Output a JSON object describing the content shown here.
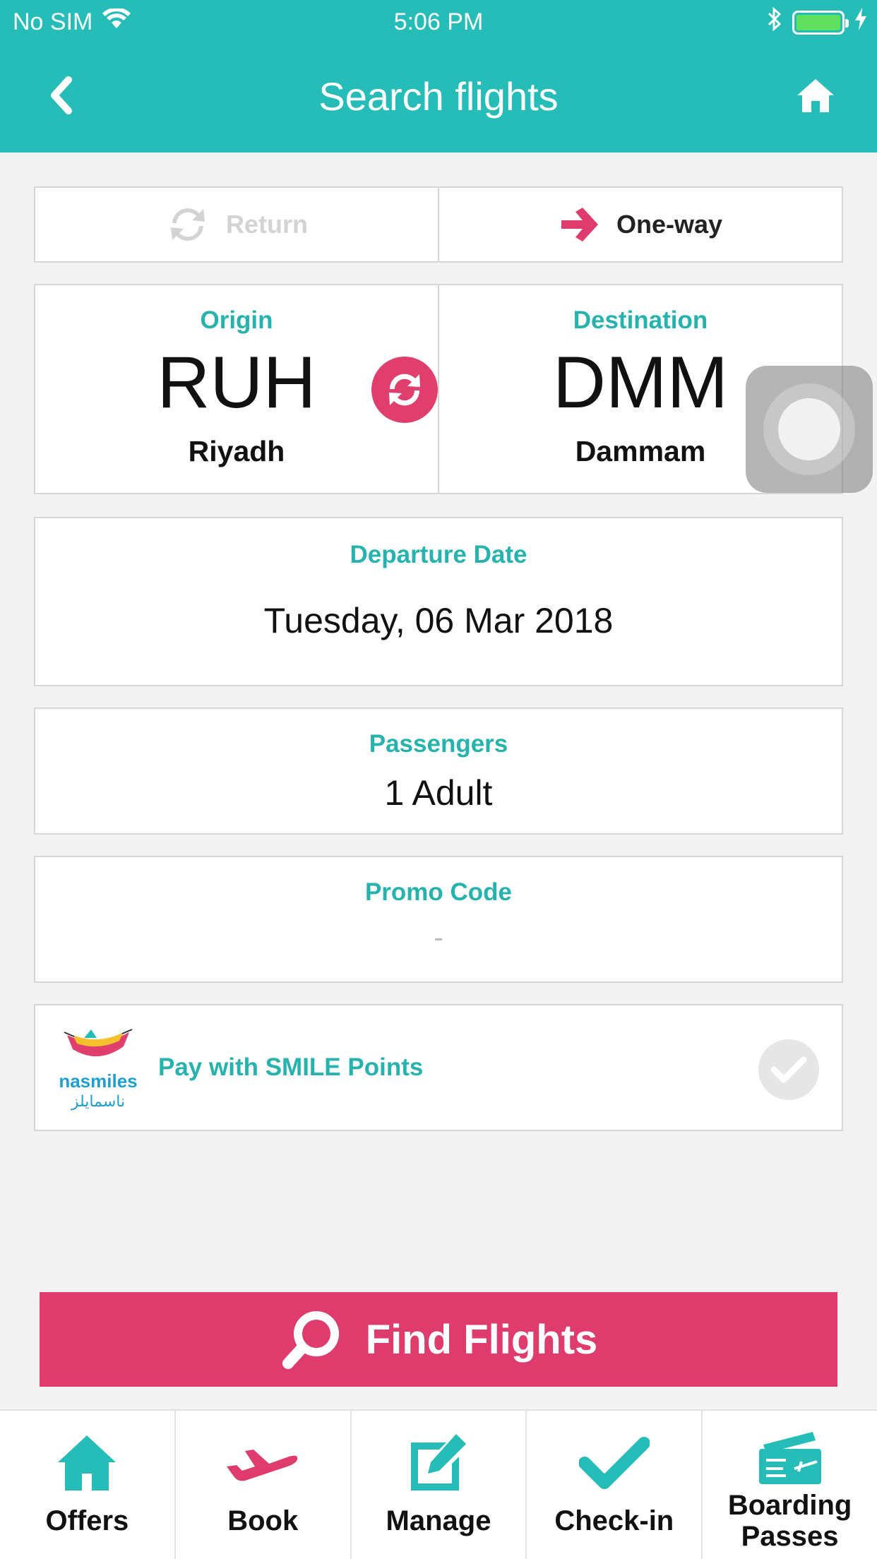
{
  "status_bar": {
    "carrier": "No SIM",
    "time": "5:06 PM"
  },
  "header": {
    "title": "Search flights"
  },
  "trip_type": {
    "return_label": "Return",
    "oneway_label": "One-way",
    "selected": "One-way"
  },
  "route": {
    "origin_label": "Origin",
    "origin_code": "RUH",
    "origin_city": "Riyadh",
    "destination_label": "Destination",
    "destination_code": "DMM",
    "destination_city": "Dammam"
  },
  "departure": {
    "label": "Departure Date",
    "value": "Tuesday, 06 Mar 2018"
  },
  "passengers": {
    "label": "Passengers",
    "value": "1 Adult"
  },
  "promo": {
    "label": "Promo Code",
    "value": "-"
  },
  "smile": {
    "logo_text": "nasmiles",
    "logo_text_ar": "ناسمايلز",
    "label": "Pay with SMILE Points",
    "checked": false
  },
  "find_button": {
    "label": "Find Flights"
  },
  "tabs": [
    {
      "label": "Offers",
      "icon": "home-icon"
    },
    {
      "label": "Book",
      "icon": "plane-icon"
    },
    {
      "label": "Manage",
      "icon": "edit-icon"
    },
    {
      "label": "Check-in",
      "icon": "check-icon"
    },
    {
      "label": "Boarding Passes",
      "icon": "ticket-icon"
    }
  ],
  "colors": {
    "teal": "#26bdb9",
    "pink": "#df3c6d",
    "background": "#f3f3f3"
  }
}
